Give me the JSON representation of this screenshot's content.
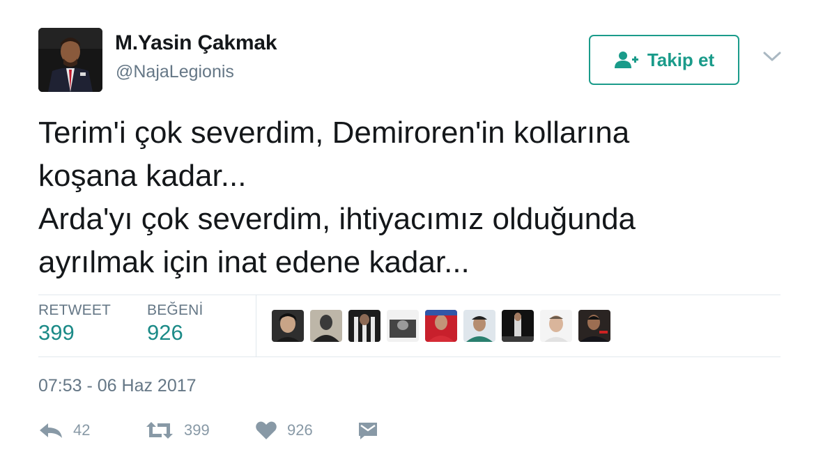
{
  "profile": {
    "name": "M.Yasin Çakmak",
    "handle": "@NajaLegionis"
  },
  "follow_button": {
    "label": "Takip et",
    "icon": "add-user-icon"
  },
  "tweet": {
    "lines": [
      "Terim'i çok severdim, Demiroren'in kollarına",
      "koşana kadar...",
      "Arda'yı çok severdim, ihtiyacımız olduğunda",
      "ayrılmak için inat edene kadar..."
    ]
  },
  "stats": {
    "retweet_label": "RETWEET",
    "retweet_count": "399",
    "like_label": "BEĞENİ",
    "like_count": "926"
  },
  "likers_count": 9,
  "timestamp": "07:53 - 06 Haz 2017",
  "actions": {
    "reply": {
      "icon": "reply-icon",
      "count": "42"
    },
    "retweet": {
      "icon": "retweet-icon",
      "count": "399"
    },
    "like": {
      "icon": "heart-icon",
      "count": "926"
    },
    "message": {
      "icon": "envelope-icon"
    }
  },
  "colors": {
    "accent": "#1a9b8a",
    "stat_value": "#1b8a87",
    "muted": "#657786",
    "action_gray": "#8899a6",
    "text": "#14171a"
  }
}
